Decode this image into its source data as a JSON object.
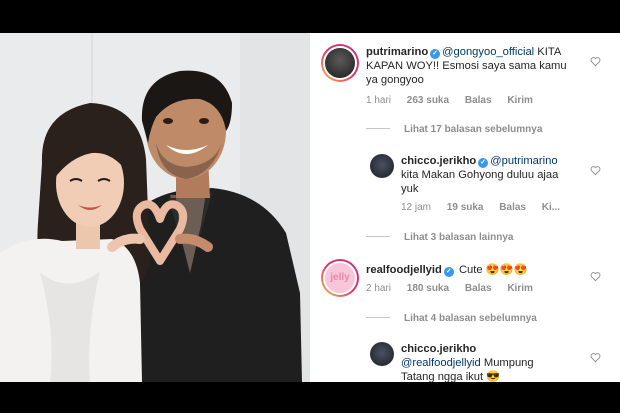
{
  "photo": {
    "description_icons": [
      "heart-hands"
    ]
  },
  "comments": [
    {
      "username": "putrimarino",
      "verified_badge": "✓",
      "mention": "@gongyoo_official",
      "text_line1": " KITA",
      "text_line2": "KAPAN WOY!! Esmosi saya sama kamu",
      "text_line3": "ya gongyoo",
      "time": "1 hari",
      "likes": "263 suka",
      "reply": "Balas",
      "send": "Kirim"
    },
    {
      "username": "chicco.jerikho",
      "verified_badge": "✓",
      "mention": "@putrimarino",
      "text_line2": "kita Makan Gohyong duluu ajaa",
      "text_line3": "yuk",
      "time": "12 jam",
      "likes": "19 suka",
      "reply": "Balas",
      "send": "Ki..."
    },
    {
      "username": "realfoodjellyid",
      "verified_badge": "✓",
      "text": "Cute 😍😍😍",
      "time": "2 hari",
      "likes": "180 suka",
      "reply": "Balas",
      "send": "Kirim"
    },
    {
      "username": "chicco.jerikho",
      "mention": "@realfoodjellyid",
      "text_line1": " Mumpung",
      "text_line2": "Tatang ngga ikut 😎"
    }
  ],
  "view_replies": [
    "Lihat 17 balasan sebelumnya",
    "Lihat 3 balasan lainnya",
    "Lihat 4 balasan sebelumnya"
  ],
  "avatars": {
    "jelly_label": "jelly"
  },
  "colors": {
    "link": "#00376b",
    "verified": "#3897f0",
    "muted": "#8e8e8e"
  }
}
